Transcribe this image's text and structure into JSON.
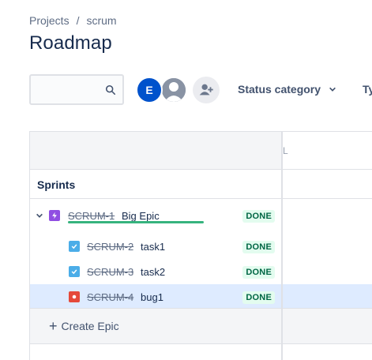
{
  "breadcrumb": {
    "items": [
      "Projects",
      "scrum"
    ],
    "separator": "/"
  },
  "page": {
    "title": "Roadmap"
  },
  "search": {
    "value": "",
    "placeholder": ""
  },
  "avatars": {
    "current_user_initial": "E"
  },
  "filters": {
    "status_category": "Status category",
    "type": "Ty"
  },
  "timeline": {
    "month_label": "L"
  },
  "sprints": {
    "label": "Sprints"
  },
  "issues": [
    {
      "key": "SCRUM-1",
      "summary": "Big Epic",
      "status": "DONE",
      "type": "epic",
      "color": "#904ee2"
    },
    {
      "key": "SCRUM-2",
      "summary": "task1",
      "status": "DONE",
      "type": "task",
      "color": "#4bade8"
    },
    {
      "key": "SCRUM-3",
      "summary": "task2",
      "status": "DONE",
      "type": "task",
      "color": "#4bade8"
    },
    {
      "key": "SCRUM-4",
      "summary": "bug1",
      "status": "DONE",
      "type": "bug",
      "color": "#e5493a"
    }
  ],
  "epic_progress": {
    "done_fraction": 1.0,
    "color": "#36b37e"
  },
  "create_epic": {
    "label": "Create Epic"
  },
  "colors": {
    "selected_row": "#deebff",
    "done_badge_bg": "#e3fcef",
    "done_badge_text": "#006644",
    "avatar_blue": "#0052cc"
  }
}
